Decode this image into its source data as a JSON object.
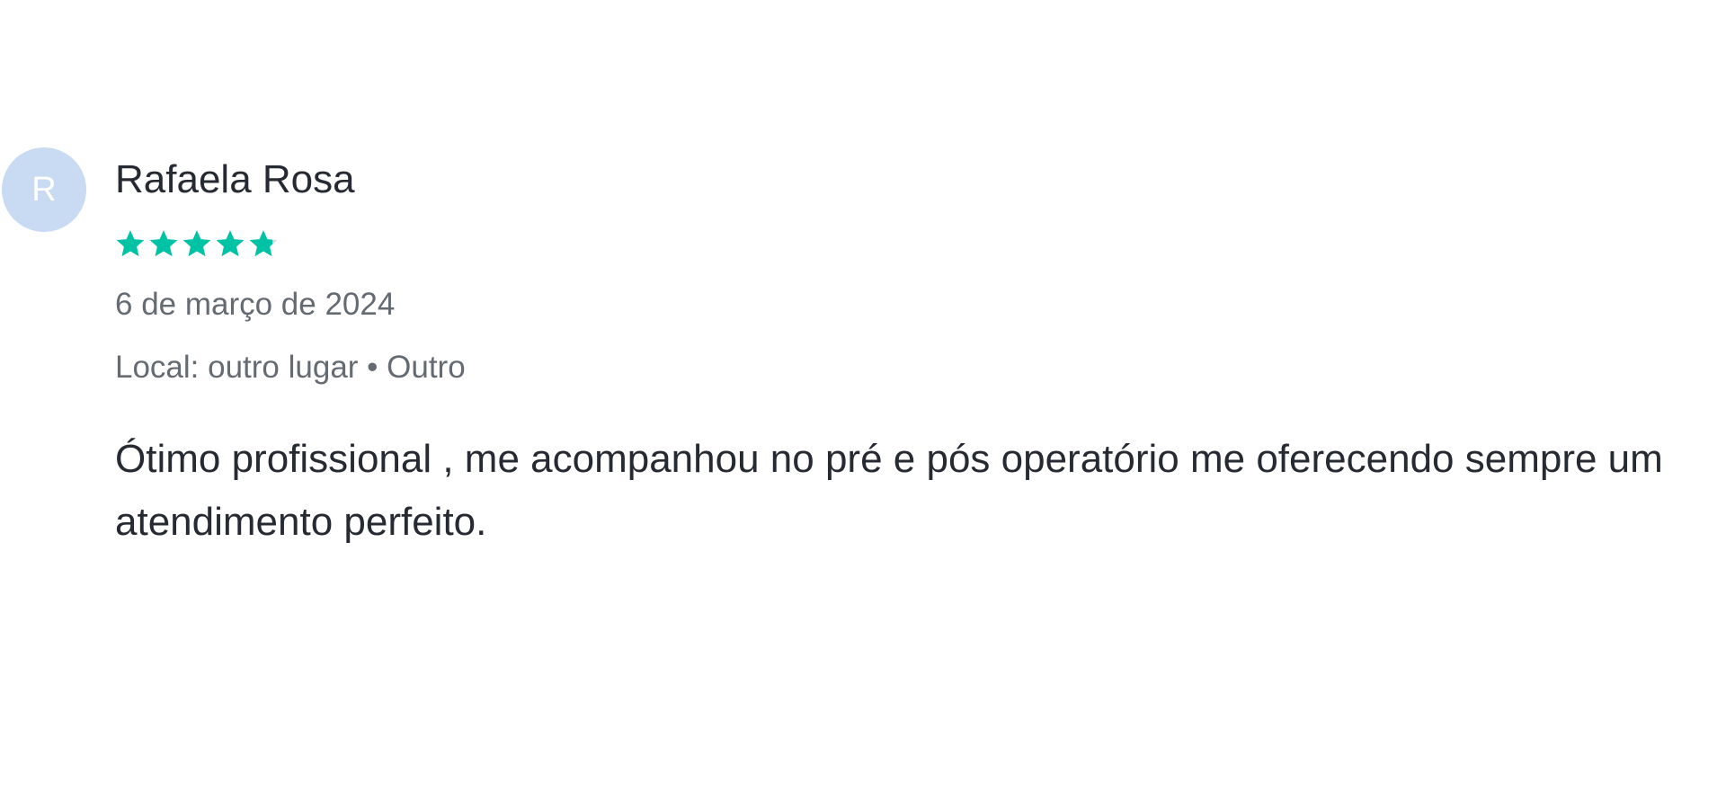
{
  "review": {
    "avatar_letter": "R",
    "reviewer_name": "Rafaela Rosa",
    "rating": {
      "value": 4.8,
      "max": 5,
      "icon": "star-icon",
      "color": "#00c3a5",
      "empty_color": "#d7dde3"
    },
    "date": "6 de março de 2024",
    "meta": "Local: outro lugar • Outro",
    "body": "Ótimo profissional , me acompanhou no pré e pós operatório me oferecendo sempre um atendimento perfeito."
  },
  "colors": {
    "avatar_bg": "#c9daf3",
    "text_primary": "#262b33",
    "text_secondary": "#646b73"
  }
}
